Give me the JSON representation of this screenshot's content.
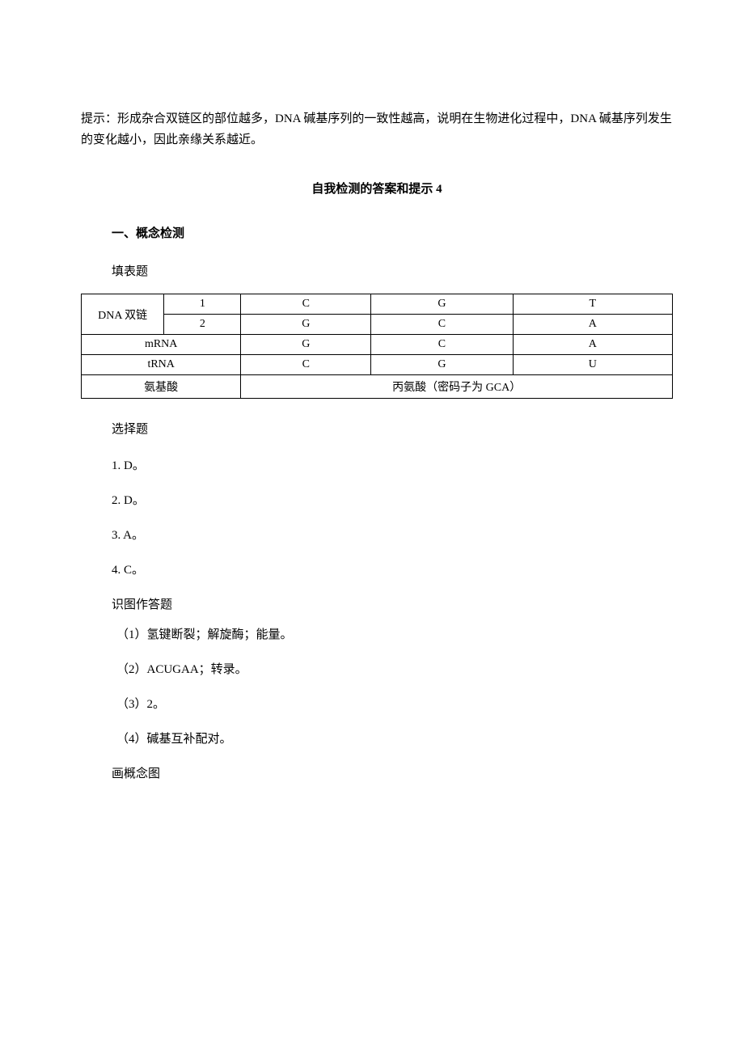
{
  "intro": "提示：形成杂合双链区的部位越多，DNA 碱基序列的一致性越高，说明在生物进化过程中，DNA 碱基序列发生的变化越小，因此亲缘关系越近。",
  "section_title": "自我检测的答案和提示 4",
  "concept_check": "一、概念检测",
  "fill_table_label": "填表题",
  "table": {
    "dna_label": "DNA 双链",
    "r1": {
      "c0": "1",
      "c1": "C",
      "c2": "G",
      "c3": "T"
    },
    "r2": {
      "c0": "2",
      "c1": "G",
      "c2": "C",
      "c3": "A"
    },
    "mrna_label": "mRNA",
    "r3": {
      "c1": "G",
      "c2": "C",
      "c3": "A"
    },
    "trna_label": "tRNA",
    "r4": {
      "c1": "C",
      "c2": "G",
      "c3": "U"
    },
    "aa_label": "氨基酸",
    "aa_value": "丙氨酸（密码子为 GCA）"
  },
  "choice_label": "选择题",
  "choices": {
    "q1": "1. D。",
    "q2": "2. D。",
    "q3": "3. A。",
    "q4": "4. C。"
  },
  "diagram_label": "识图作答题",
  "diagram_answers": {
    "a1": "（1）氢键断裂；解旋酶；能量。",
    "a2": "（2）ACUGAA；转录。",
    "a3": "（3）2。",
    "a4": "（4）碱基互补配对。"
  },
  "concept_map_label": "画概念图"
}
